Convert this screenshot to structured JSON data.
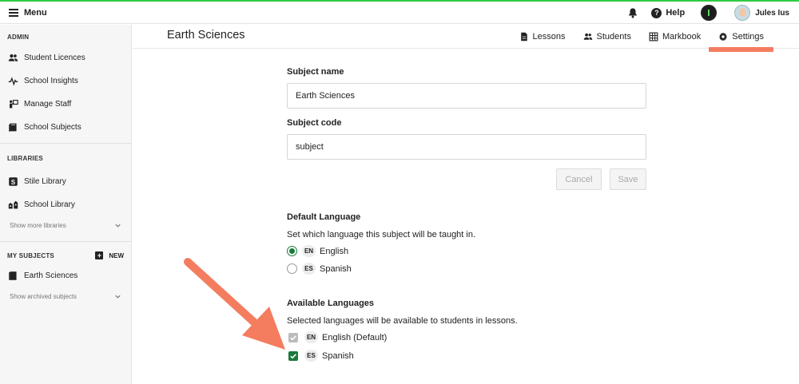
{
  "topbar": {
    "menu_label": "Menu",
    "help_label": "Help",
    "user_name": "Jules Ius"
  },
  "sidebar": {
    "admin_heading": "ADMIN",
    "admin_items": [
      {
        "label": "Student Licences",
        "icon": "people-icon"
      },
      {
        "label": "School Insights",
        "icon": "pulse-icon"
      },
      {
        "label": "Manage Staff",
        "icon": "staff-icon"
      },
      {
        "label": "School Subjects",
        "icon": "books-icon"
      }
    ],
    "libraries_heading": "LIBRARIES",
    "library_items": [
      {
        "label": "Stile Library",
        "icon": "stile-icon"
      },
      {
        "label": "School Library",
        "icon": "school-icon"
      }
    ],
    "show_more_libraries": "Show more libraries",
    "my_subjects_heading": "MY SUBJECTS",
    "new_label": "NEW",
    "subject_items": [
      {
        "label": "Earth Sciences",
        "icon": "book-icon"
      }
    ],
    "show_archived": "Show archived subjects"
  },
  "header": {
    "title": "Earth Sciences",
    "tabs": [
      {
        "label": "Lessons",
        "icon": "document-icon"
      },
      {
        "label": "Students",
        "icon": "people-icon"
      },
      {
        "label": "Markbook",
        "icon": "grid-icon"
      },
      {
        "label": "Settings",
        "icon": "gear-icon",
        "active": true
      }
    ]
  },
  "settings": {
    "subject_name_label": "Subject name",
    "subject_name_value": "Earth Sciences",
    "subject_code_label": "Subject code",
    "subject_code_value": "subject",
    "cancel_label": "Cancel",
    "save_label": "Save",
    "default_language_heading": "Default Language",
    "default_language_desc": "Set which language this subject will be taught in.",
    "default_languages": [
      {
        "code": "EN",
        "name": "English",
        "selected": true
      },
      {
        "code": "ES",
        "name": "Spanish",
        "selected": false
      }
    ],
    "available_languages_heading": "Available Languages",
    "available_languages_desc": "Selected languages will be available to students in lessons.",
    "available_languages": [
      {
        "code": "EN",
        "name": "English (Default)",
        "checked": true,
        "disabled": true
      },
      {
        "code": "ES",
        "name": "Spanish",
        "checked": true,
        "disabled": false
      }
    ]
  },
  "colors": {
    "accent_green": "#1a7a3a",
    "tab_underline": "#f47c5f",
    "top_line": "#2ecc40",
    "annotation_arrow": "#f47c5f"
  }
}
